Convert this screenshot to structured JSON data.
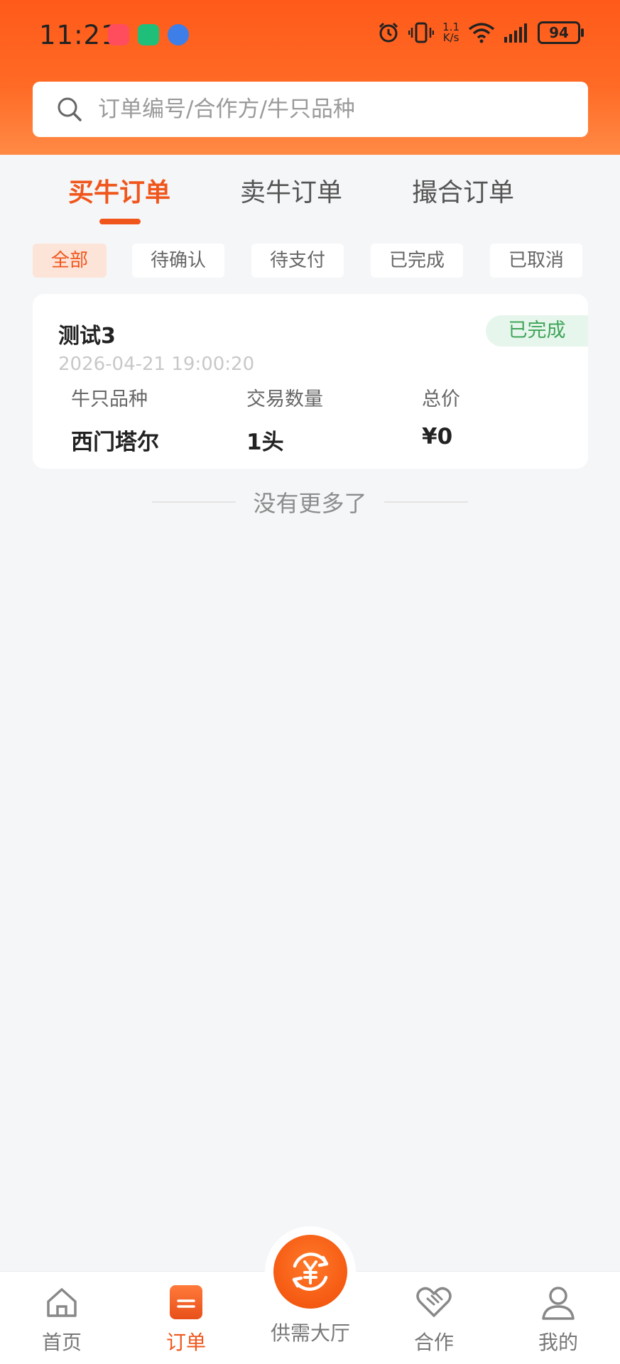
{
  "status_bar": {
    "time": "11:21",
    "net_speed_value": "1.1",
    "net_speed_unit": "K/s",
    "battery": "94"
  },
  "search": {
    "placeholder": "订单编号/合作方/牛只品种"
  },
  "tabs": [
    {
      "label": "买牛订单",
      "active": true
    },
    {
      "label": "卖牛订单",
      "active": false
    },
    {
      "label": "撮合订单",
      "active": false
    }
  ],
  "filters": [
    {
      "label": "全部",
      "active": true
    },
    {
      "label": "待确认",
      "active": false
    },
    {
      "label": "待支付",
      "active": false
    },
    {
      "label": "已完成",
      "active": false
    },
    {
      "label": "已取消",
      "active": false
    }
  ],
  "orders": [
    {
      "title": "测试3",
      "status": "已完成",
      "time": "2026-04-21 19:00:20",
      "fields": [
        {
          "label": "牛只品种",
          "value": "西门塔尔"
        },
        {
          "label": "交易数量",
          "value": "1头"
        },
        {
          "label": "总价",
          "value": "¥0"
        }
      ]
    }
  ],
  "list_end_text": "没有更多了",
  "bottom_nav": [
    {
      "label": "首页",
      "icon": "home-icon",
      "active": false
    },
    {
      "label": "订单",
      "icon": "order-icon",
      "active": true
    },
    {
      "label": "供需大厅",
      "icon": "exchange-icon",
      "active": false
    },
    {
      "label": "合作",
      "icon": "handshake-icon",
      "active": false
    },
    {
      "label": "我的",
      "icon": "user-icon",
      "active": false
    }
  ],
  "colors": {
    "accent": "#f0561c",
    "header_gradient_start": "#ff5a1a",
    "success": "#3fa55a"
  }
}
